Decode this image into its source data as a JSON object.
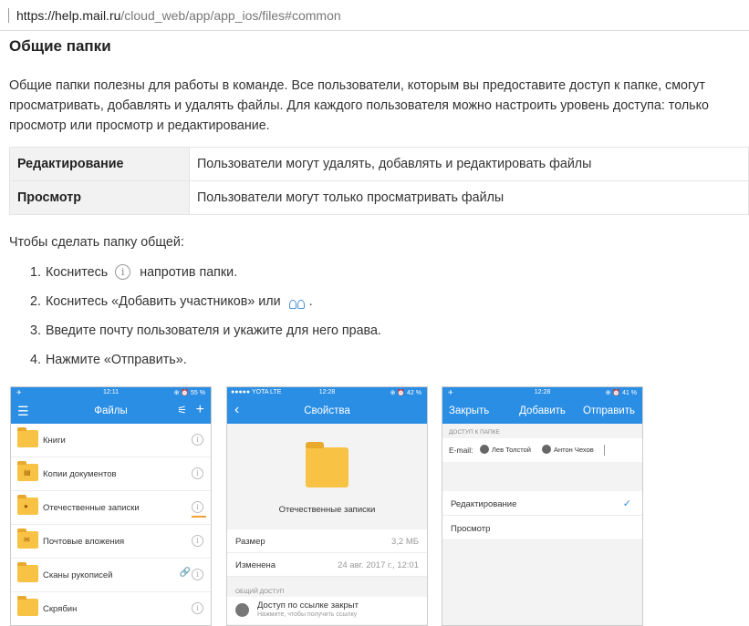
{
  "browser": {
    "url_host": "https://help.mail.ru",
    "url_path": "/cloud_web/app/app_ios/files#common"
  },
  "article": {
    "title": "Общие папки",
    "intro": "Общие папки полезны для работы в команде. Все пользователи, которым вы предоставите доступ к папке, смогут просматривать, добавлять и удалять файлы. Для каждого пользователя можно настроить уровень доступа: только просмотр или просмотр и редактирование.",
    "table": [
      {
        "key": "Редактирование",
        "value": "Пользователи могут удалять, добавлять и редактировать файлы"
      },
      {
        "key": "Просмотр",
        "value": "Пользователи могут только просматривать файлы"
      }
    ],
    "lead": "Чтобы сделать папку общей:",
    "steps": [
      {
        "num": "1.",
        "before": "Коснитесь",
        "after": "напротив папки."
      },
      {
        "num": "2.",
        "before": "Коснитесь «Добавить участников» или",
        "after": "."
      },
      {
        "num": "3.",
        "text": "Введите почту пользователя и укажите для него права."
      },
      {
        "num": "4.",
        "text": "Нажмите «Отправить»."
      }
    ]
  },
  "phone1": {
    "status_time": "12:11",
    "status_right": "⊕ ⏰ 55 %",
    "title": "Файлы",
    "folders": [
      {
        "name": "Книги"
      },
      {
        "name": "Копии документов"
      },
      {
        "name": "Отечественные записки"
      },
      {
        "name": "Почтовые вложения"
      },
      {
        "name": "Сканы рукописей"
      },
      {
        "name": "Скрябин"
      }
    ]
  },
  "phone2": {
    "status_left": "●●●●● YOTA  LTE",
    "status_time": "12:28",
    "status_right": "⊕ ⏰ 42 %",
    "title": "Свойства",
    "folder_name": "Отечественные записки",
    "size_label": "Размер",
    "size_value": "3,2 МБ",
    "changed_label": "Изменена",
    "changed_value": "24 авг. 2017 г., 12:01",
    "section": "ОБЩИЙ ДОСТУП",
    "access_title": "Доступ по ссылке закрыт",
    "access_sub": "Нажмите, чтобы получить ссылку"
  },
  "phone3": {
    "status_time": "12:28",
    "status_right": "⊕ ⏰ 41 %",
    "close": "Закрыть",
    "add": "Добавить",
    "send": "Отправить",
    "section": "ДОСТУП К ПАПКЕ",
    "email_label": "E-mail:",
    "users": [
      "Лев Толстой",
      "Антон Чехов"
    ],
    "option_edit": "Редактирование",
    "option_view": "Просмотр",
    "check": "✓"
  },
  "colors": {
    "accent": "#2a8ee4",
    "folder": "#f8c245"
  }
}
